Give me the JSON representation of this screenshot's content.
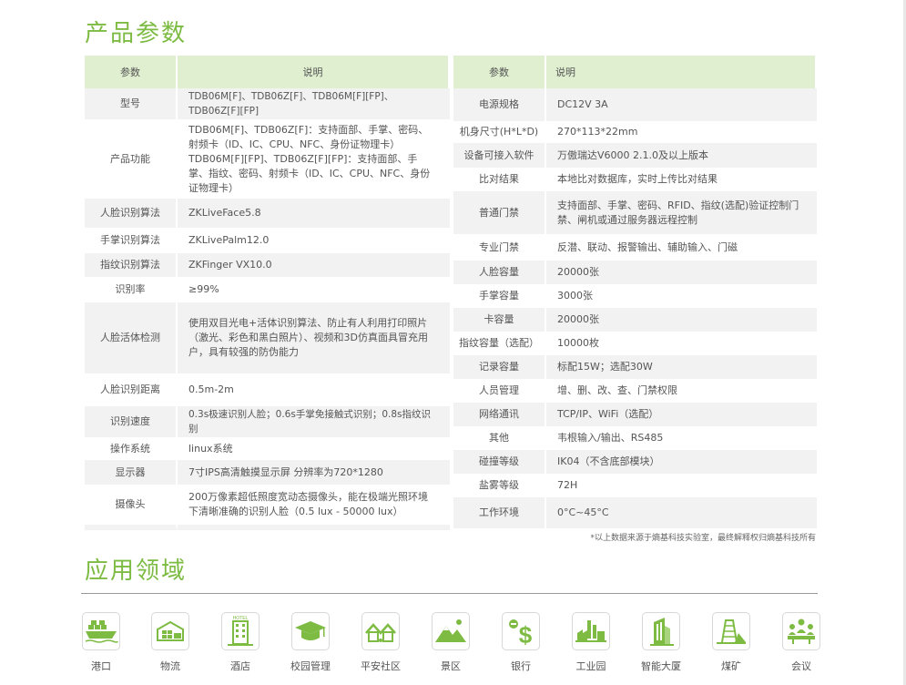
{
  "params_title": "产品参数",
  "apps_title": "应用领域",
  "footnote": "*以上数据来源于熵基科技实验室，最终解释权归熵基科技所有",
  "left_table": {
    "headers": [
      "参数",
      "说明"
    ],
    "rows": [
      {
        "k": "型号",
        "v": "TDB06M[F]、TDB06Z[F]、TDB06M[F][FP]、TDB06Z[F][FP]"
      },
      {
        "k": "产品功能",
        "v": "TDB06M[F]、TDB06Z[F]：支持面部、手掌、密码、射频卡（ID、IC、CPU、NFC、身份证物理卡）TDB06M[F][FP]、TDB06Z[F][FP]：支持面部、手掌、指纹、密码、射频卡（ID、IC、CPU、NFC、身份证物理卡）"
      },
      {
        "k": "人脸识别算法",
        "v": "ZKLiveFace5.8"
      },
      {
        "k": "手掌识别算法",
        "v": "ZKLivePalm12.0"
      },
      {
        "k": "指纹识别算法",
        "v": "ZKFinger VX10.0"
      },
      {
        "k": "识别率",
        "v": "≥99%"
      },
      {
        "k": "人脸活体检测",
        "v": "使用双目光电+活体识别算法、防止有人利用打印照片（激光、彩色和黑白照片）、视频和3D仿真面具冒充用户，具有较强的防伪能力"
      },
      {
        "k": "人脸识别距离",
        "v": "0.5m-2m"
      },
      {
        "k": "识别速度",
        "v": "0.3s极速识别人脸；0.6s手掌免接触式识别；0.8s指纹识别"
      },
      {
        "k": "操作系统",
        "v": "linux系统"
      },
      {
        "k": "显示器",
        "v": "7寸IPS高清触摸显示屏  分辨率为720*1280"
      },
      {
        "k": "摄像头",
        "v": "200万像素超低照度宽动态摄像头，能在极端光照环境下清晰准确的识别人脸（0.5 lux - 50000 lux）"
      }
    ]
  },
  "right_table": {
    "headers": [
      "参数",
      "说明"
    ],
    "rows": [
      {
        "k": "电源规格",
        "v": "DC12V 3A"
      },
      {
        "k": "机身尺寸(H*L*D)",
        "v": "270*113*22mm"
      },
      {
        "k": "设备可接入软件",
        "v": "万傲瑞达V6000 2.1.0及以上版本"
      },
      {
        "k": "比对结果",
        "v": "本地比对数据库，实时上传比对结果"
      },
      {
        "k": "普通门禁",
        "v": "支持面部、手掌、密码、RFID、指纹(选配)验证控制门禁、闸机或通过服务器远程控制"
      },
      {
        "k": "专业门禁",
        "v": "反潜、联动、报警输出、辅助输入、门磁"
      },
      {
        "k": "人脸容量",
        "v": "20000张"
      },
      {
        "k": "手掌容量",
        "v": "3000张"
      },
      {
        "k": "卡容量",
        "v": "20000张"
      },
      {
        "k": "指纹容量（选配）",
        "v": "10000枚"
      },
      {
        "k": "记录容量",
        "v": "标配15W；选配30W"
      },
      {
        "k": "人员管理",
        "v": "增、删、改、查、门禁权限"
      },
      {
        "k": "网络通讯",
        "v": "TCP/IP、WiFi（选配）"
      },
      {
        "k": "其他",
        "v": "韦根输入/输出、RS485"
      },
      {
        "k": "碰撞等级",
        "v": "IK04（不含底部模块）"
      },
      {
        "k": "盐雾等级",
        "v": "72H"
      },
      {
        "k": "工作环境",
        "v": "0°C~45°C"
      }
    ]
  },
  "applications": [
    {
      "label": "港口",
      "icon": "port-icon"
    },
    {
      "label": "物流",
      "icon": "logistics-icon"
    },
    {
      "label": "酒店",
      "icon": "hotel-icon",
      "badge": "HOTEL"
    },
    {
      "label": "校园管理",
      "icon": "graduation-cap-icon"
    },
    {
      "label": "平安社区",
      "icon": "community-icon"
    },
    {
      "label": "景区",
      "icon": "scenic-mountain-icon"
    },
    {
      "label": "银行",
      "icon": "bank-dollar-icon"
    },
    {
      "label": "工业园",
      "icon": "factory-icon"
    },
    {
      "label": "智能大厦",
      "icon": "smart-building-icon"
    },
    {
      "label": "煤矿",
      "icon": "coal-mine-icon"
    },
    {
      "label": "会议",
      "icon": "meeting-icon"
    }
  ],
  "colors": {
    "accent": "#7dbb42",
    "header_bg": "#dfefcf",
    "row_alt": "#f2f2f2",
    "text": "#555555"
  }
}
